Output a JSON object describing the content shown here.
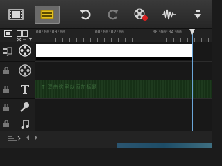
{
  "toolbar": {
    "items": [
      {
        "name": "filmstrip-view",
        "icon": "filmstrip-icon"
      },
      {
        "name": "storyboard-view",
        "icon": "storyboard-icon",
        "active": true
      },
      {
        "name": "undo",
        "icon": "undo-icon"
      },
      {
        "name": "redo",
        "icon": "redo-icon"
      },
      {
        "name": "record-capture",
        "icon": "record-capture-icon"
      },
      {
        "name": "audio-mixer",
        "icon": "audio-mixer-icon"
      },
      {
        "name": "more",
        "icon": "more-icon"
      }
    ]
  },
  "ruler": {
    "ticks": [
      "00:00:00:00",
      "00:00:02:00",
      "00:00:04:00"
    ]
  },
  "tracks": {
    "title_overlay_text": "T 双击这里以添加标题"
  },
  "colors": {
    "playhead": "#6aa6d8",
    "title_track": "#1e3a1e",
    "active_tool": "#6a6a6a"
  }
}
